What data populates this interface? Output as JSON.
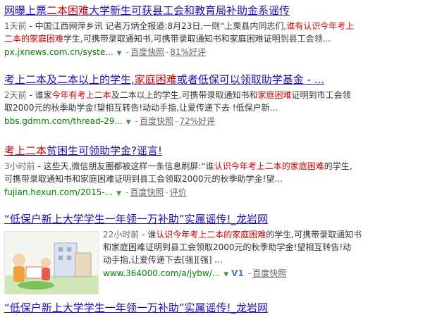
{
  "results": [
    {
      "title": [
        "网曝上票",
        "二本困难",
        "大学新生可获县工会和教育局补助金系谣传"
      ],
      "abstract_lines": [
        [
          "1天前",
          " - 中国江西网萍乡讯 记者万炳全报道:8月23日,一则“上栗县内同志们,",
          "谁有认识今年考上"
        ],
        [
          "二本的家庭困难",
          "学生,可携带录取通知书,可携带录取通知书和家庭困难证明到县工会领..."
        ]
      ],
      "url": "px.jxnews.com.cn/syste...",
      "cache": "百度快照",
      "extra": "81%好评"
    },
    {
      "title": [
        "考上二本及二本以上的学生,",
        "家庭困难",
        "或者低保可以领取助学基金 - ..."
      ],
      "abstract_lines": [
        [
          "2天前",
          " - 谁家",
          "今年有考上二本",
          "及二本以上的学生,可携带录取通知书和",
          "家庭困难",
          "证明到市工会领"
        ],
        [
          "取2000元的秋季助学金!望相互转告!动动手指,让爱传递下去 !低保户新..."
        ]
      ],
      "url": "bbs.gdmm.com/thread-29...",
      "cache": "百度快照",
      "extra": "72%好评"
    },
    {
      "title": [
        "考上二本",
        "贫困生可领助学金?谣言!"
      ],
      "abstract_lines": [
        [
          "3小时前",
          " - 这些天,微信朋友圈都被这样一条信息刷屏:“谁",
          "认识今年考上二本的家庭困难",
          "的学生,"
        ],
        [
          "可携带录取通知书和家庭困难证明到县工会领取2000元的秋季助学金!望..."
        ]
      ],
      "url": "fujian.hexun.com/2015-...",
      "cache": "百度快照",
      "extra": "评价"
    },
    {
      "title": [
        "“低保户新上大学学生一年领一万补助”实属谣传!_龙岩网"
      ],
      "abstract_lines": [
        [
          "22小时前",
          " - 谁",
          "认识今年考上二本的家庭困难",
          "的学生,可携带录取通知书"
        ],
        [
          "和家庭困难证明到县工会领取2000元的秋季助学金!望相互转告!动"
        ],
        [
          "动手指,让爱传递下去[强][强] ..."
        ]
      ],
      "url": "www.364000.com/a/jybw/...",
      "badge": "V1",
      "cache": "百度快照",
      "thumb_icon": "illustration-thumbnail"
    },
    {
      "title": [
        "“低保户新上大学学生一年领一万补助”实属谣传!_龙岩网"
      ]
    }
  ],
  "colors": {
    "link": "#1a0dab",
    "highlight": "#cc0000",
    "url": "#008000",
    "meta": "#666666"
  }
}
